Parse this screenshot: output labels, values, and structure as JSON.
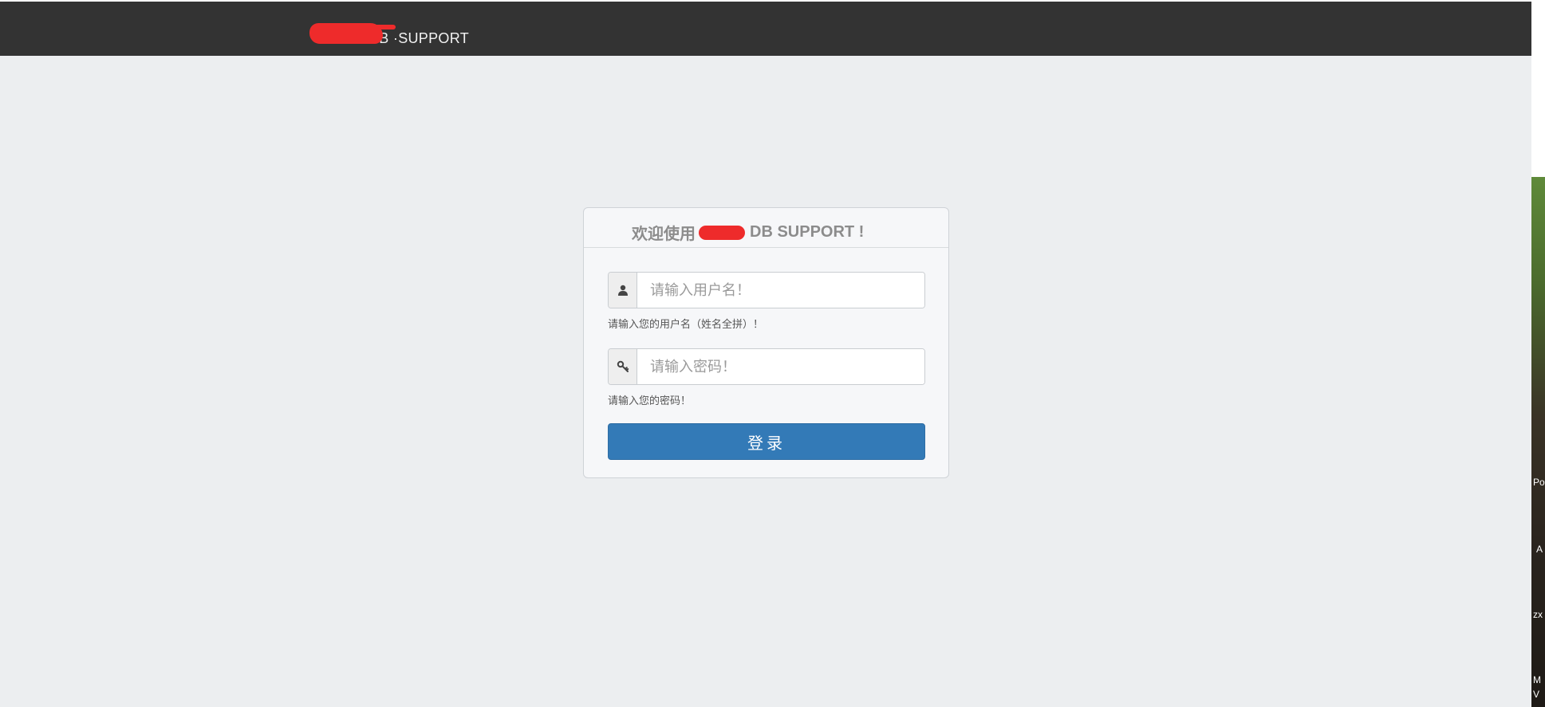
{
  "header": {
    "brand_text": "DB ·SUPPORT"
  },
  "login": {
    "title_prefix": "欢迎使用",
    "title_suffix": "DB SUPPORT !",
    "username": {
      "placeholder": "请输入用户名！",
      "help": "请输入您的用户名（姓名全拼）！",
      "icon": "user-icon"
    },
    "password": {
      "placeholder": "请输入密码！",
      "help": "请输入您的密码！",
      "icon": "key-icon"
    },
    "submit_label": "登录"
  },
  "side_panel": {
    "labels": [
      "Po",
      "A",
      "zx",
      "M",
      "V"
    ]
  },
  "colors": {
    "topbar": "#333333",
    "background": "#eceef0",
    "primary_button": "#337ab7",
    "redaction": "#ee2b2b"
  }
}
